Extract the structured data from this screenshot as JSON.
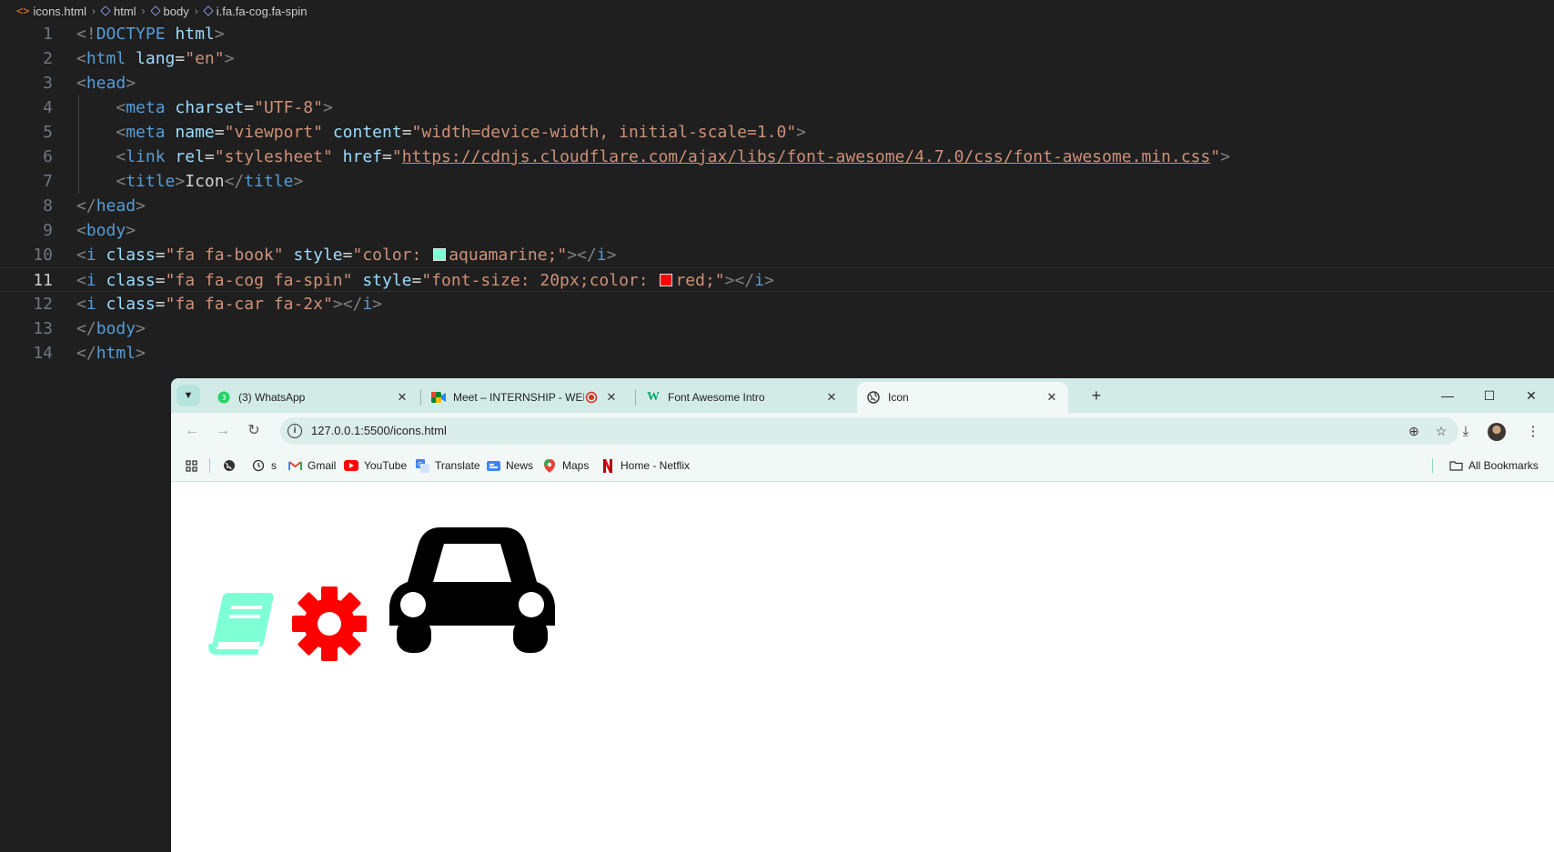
{
  "editor": {
    "breadcrumb": [
      "icons.html",
      "html",
      "body",
      "i.fa.fa-cog.fa-spin"
    ],
    "colors": {
      "background": "#1f1f1f",
      "tag": "#569cd6",
      "attribute": "#9cdcfe",
      "string": "#ce9178",
      "line_number": "#6e7681"
    },
    "active_line": 11,
    "lines": [
      {
        "n": "1",
        "indent": "",
        "parts": [
          [
            "br",
            "<!"
          ],
          [
            "tag",
            "DOCTYPE"
          ],
          [
            "txt",
            " "
          ],
          [
            "att",
            "html"
          ],
          [
            "br",
            ">"
          ]
        ]
      },
      {
        "n": "2",
        "indent": "",
        "parts": [
          [
            "br",
            "<"
          ],
          [
            "tag",
            "html"
          ],
          [
            "txt",
            " "
          ],
          [
            "att",
            "lang"
          ],
          [
            "txt",
            "="
          ],
          [
            "str",
            "\"en\""
          ],
          [
            "br",
            ">"
          ]
        ]
      },
      {
        "n": "3",
        "indent": "",
        "parts": [
          [
            "br",
            "<"
          ],
          [
            "tag",
            "head"
          ],
          [
            "br",
            ">"
          ]
        ]
      },
      {
        "n": "4",
        "indent": "    ",
        "parts": [
          [
            "br",
            "<"
          ],
          [
            "tag",
            "meta"
          ],
          [
            "txt",
            " "
          ],
          [
            "att",
            "charset"
          ],
          [
            "txt",
            "="
          ],
          [
            "str",
            "\"UTF-8\""
          ],
          [
            "br",
            ">"
          ]
        ]
      },
      {
        "n": "5",
        "indent": "    ",
        "parts": [
          [
            "br",
            "<"
          ],
          [
            "tag",
            "meta"
          ],
          [
            "txt",
            " "
          ],
          [
            "att",
            "name"
          ],
          [
            "txt",
            "="
          ],
          [
            "str",
            "\"viewport\""
          ],
          [
            "txt",
            " "
          ],
          [
            "att",
            "content"
          ],
          [
            "txt",
            "="
          ],
          [
            "str",
            "\"width=device-width, initial-scale=1.0\""
          ],
          [
            "br",
            ">"
          ]
        ]
      },
      {
        "n": "6",
        "indent": "    ",
        "parts": [
          [
            "br",
            "<"
          ],
          [
            "tag",
            "link"
          ],
          [
            "txt",
            " "
          ],
          [
            "att",
            "rel"
          ],
          [
            "txt",
            "="
          ],
          [
            "str",
            "\"stylesheet\""
          ],
          [
            "txt",
            " "
          ],
          [
            "att",
            "href"
          ],
          [
            "txt",
            "="
          ],
          [
            "str",
            "\""
          ],
          [
            "link",
            "https://cdnjs.cloudflare.com/ajax/libs/font-awesome/4.7.0/css/font-awesome.min.css"
          ],
          [
            "str",
            "\""
          ],
          [
            "br",
            ">"
          ]
        ]
      },
      {
        "n": "7",
        "indent": "    ",
        "parts": [
          [
            "br",
            "<"
          ],
          [
            "tag",
            "title"
          ],
          [
            "br",
            ">"
          ],
          [
            "txt",
            "Icon"
          ],
          [
            "br",
            "</"
          ],
          [
            "tag",
            "title"
          ],
          [
            "br",
            ">"
          ]
        ]
      },
      {
        "n": "8",
        "indent": "",
        "parts": [
          [
            "br",
            "</"
          ],
          [
            "tag",
            "head"
          ],
          [
            "br",
            ">"
          ]
        ]
      },
      {
        "n": "9",
        "indent": "",
        "parts": [
          [
            "br",
            "<"
          ],
          [
            "tag",
            "body"
          ],
          [
            "br",
            ">"
          ]
        ]
      },
      {
        "n": "10",
        "indent": "",
        "parts": [
          [
            "br",
            "<"
          ],
          [
            "tag",
            "i"
          ],
          [
            "txt",
            " "
          ],
          [
            "att",
            "class"
          ],
          [
            "txt",
            "="
          ],
          [
            "str",
            "\"fa fa-book\""
          ],
          [
            "txt",
            " "
          ],
          [
            "att",
            "style"
          ],
          [
            "txt",
            "="
          ],
          [
            "str",
            "\"color: "
          ],
          [
            "swatch",
            "#7fffd4"
          ],
          [
            "str",
            "aquamarine;\""
          ],
          [
            "br",
            "></"
          ],
          [
            "tag",
            "i"
          ],
          [
            "br",
            ">"
          ]
        ]
      },
      {
        "n": "11",
        "indent": "",
        "parts": [
          [
            "br",
            "<"
          ],
          [
            "tag",
            "i"
          ],
          [
            "txt",
            " "
          ],
          [
            "att",
            "class"
          ],
          [
            "txt",
            "="
          ],
          [
            "str",
            "\"fa fa-cog fa-spin\""
          ],
          [
            "txt",
            " "
          ],
          [
            "att",
            "style"
          ],
          [
            "txt",
            "="
          ],
          [
            "str",
            "\"font-size: 20px;color: "
          ],
          [
            "swatch",
            "#ff0000"
          ],
          [
            "str",
            "red;\""
          ],
          [
            "br",
            "></"
          ],
          [
            "tag",
            "i"
          ],
          [
            "br",
            ">"
          ]
        ]
      },
      {
        "n": "12",
        "indent": "",
        "parts": [
          [
            "br",
            "<"
          ],
          [
            "tag",
            "i"
          ],
          [
            "txt",
            " "
          ],
          [
            "att",
            "class"
          ],
          [
            "txt",
            "="
          ],
          [
            "str",
            "\"fa fa-car fa-2x\""
          ],
          [
            "br",
            "></"
          ],
          [
            "tag",
            "i"
          ],
          [
            "br",
            ">"
          ]
        ]
      },
      {
        "n": "13",
        "indent": "",
        "parts": [
          [
            "br",
            "</"
          ],
          [
            "tag",
            "body"
          ],
          [
            "br",
            ">"
          ]
        ]
      },
      {
        "n": "14",
        "indent": "",
        "parts": [
          [
            "br",
            "</"
          ],
          [
            "tag",
            "html"
          ],
          [
            "br",
            ">"
          ]
        ]
      }
    ]
  },
  "browser": {
    "tabs": [
      {
        "label": "(3) WhatsApp",
        "icon": "whatsapp-icon",
        "active": false
      },
      {
        "label": "Meet – INTERNSHIP - WEB",
        "icon": "meet-icon",
        "active": false,
        "recording": true
      },
      {
        "label": "Font Awesome Intro",
        "icon": "w3schools-icon",
        "active": false
      },
      {
        "label": "Icon",
        "icon": "globe-icon",
        "active": true
      }
    ],
    "address": {
      "url": "127.0.0.1:5500/icons.html"
    },
    "bookmarks": [
      {
        "label": "",
        "icon": "globe-icon"
      },
      {
        "label": "s",
        "icon": "history-icon"
      },
      {
        "label": "Gmail",
        "icon": "gmail-icon"
      },
      {
        "label": "YouTube",
        "icon": "youtube-icon"
      },
      {
        "label": "Translate",
        "icon": "translate-icon"
      },
      {
        "label": "News",
        "icon": "news-icon"
      },
      {
        "label": "Maps",
        "icon": "maps-icon"
      },
      {
        "label": "Home - Netflix",
        "icon": "netflix-icon"
      }
    ],
    "all_bookmarks": "All Bookmarks",
    "page": {
      "icons": [
        {
          "name": "book-icon",
          "color": "#7fffd4"
        },
        {
          "name": "cog-icon",
          "color": "#ff0000"
        },
        {
          "name": "car-icon",
          "color": "#000000"
        }
      ]
    },
    "colors": {
      "tabstrip": "#d3ebe6",
      "toolbar": "#f1f8f6",
      "omnibox": "#dceee9"
    }
  }
}
